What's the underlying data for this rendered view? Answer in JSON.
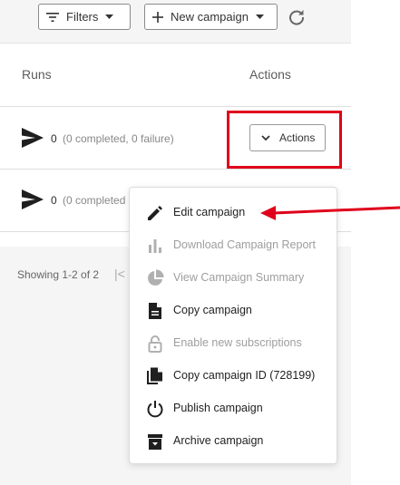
{
  "toolbar": {
    "filters_label": "Filters",
    "new_campaign_label": "New campaign"
  },
  "table": {
    "headers": {
      "runs": "Runs",
      "actions": "Actions"
    },
    "rows": [
      {
        "count": "0",
        "detail": "(0 completed, 0 failure)"
      },
      {
        "count": "0",
        "detail": "(0 completed"
      }
    ],
    "actions_button_label": "Actions"
  },
  "pagination": {
    "text": "Showing 1-2 of 2",
    "first_glyph": "|<"
  },
  "menu": {
    "items": [
      {
        "label": "Edit campaign",
        "icon": "pencil-icon",
        "enabled": true
      },
      {
        "label": "Download Campaign Report",
        "icon": "bar-chart-icon",
        "enabled": false
      },
      {
        "label": "View Campaign Summary",
        "icon": "pie-chart-icon",
        "enabled": false
      },
      {
        "label": "Copy campaign",
        "icon": "document-icon",
        "enabled": true
      },
      {
        "label": "Enable new subscriptions",
        "icon": "lock-icon",
        "enabled": false
      },
      {
        "label": "Copy campaign ID (728199)",
        "icon": "copy-icon",
        "enabled": true
      },
      {
        "label": "Publish campaign",
        "icon": "power-icon",
        "enabled": true
      },
      {
        "label": "Archive campaign",
        "icon": "archive-icon",
        "enabled": true
      }
    ]
  },
  "colors": {
    "highlight": "#e0001b",
    "disabled_text": "#9e9e9e"
  }
}
